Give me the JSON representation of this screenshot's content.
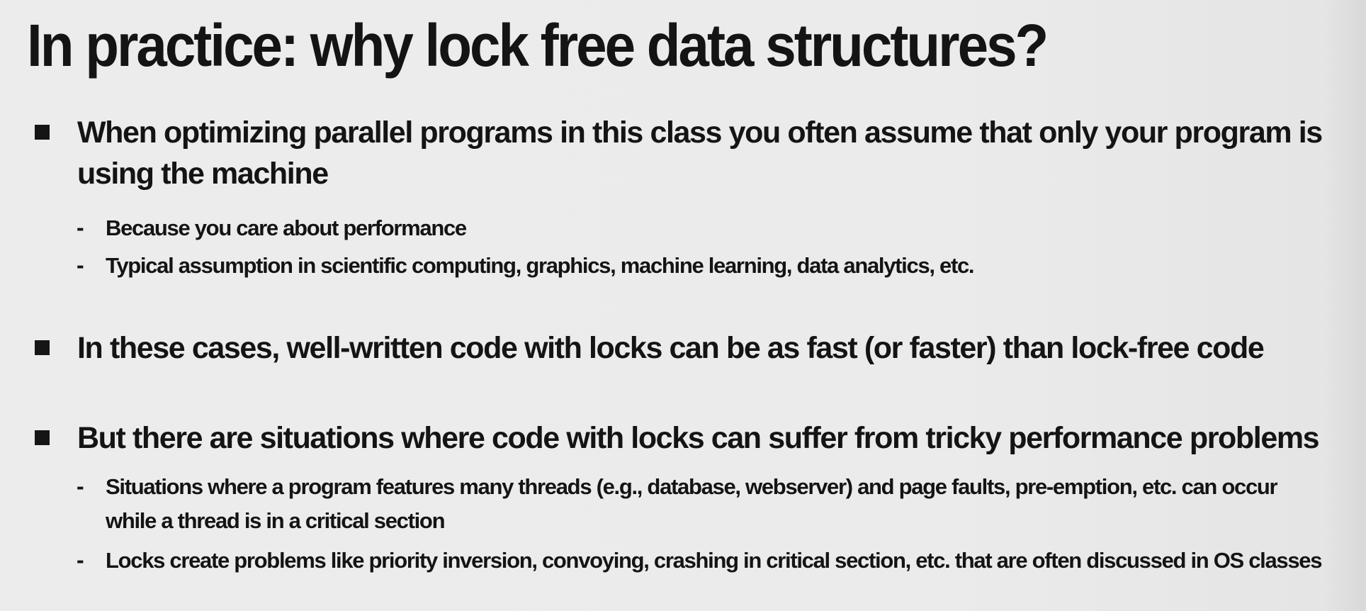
{
  "slide": {
    "title": "In practice: why lock free data structures?",
    "bullets": [
      {
        "lines": [
          "When optimizing parallel programs in this class you often assume that only your program is",
          "using the machine"
        ],
        "subs": [
          {
            "lines": [
              "Because you care about performance"
            ]
          },
          {
            "lines": [
              "Typical assumption in scientific computing, graphics, machine learning, data analytics, etc."
            ]
          }
        ]
      },
      {
        "lines": [
          "In these cases, well-written code with locks can be as fast (or faster) than lock-free code"
        ],
        "subs": []
      },
      {
        "lines": [
          "But there are situations where code with locks can suffer from tricky performance problems"
        ],
        "subs": [
          {
            "lines": [
              "Situations where a program features many threads (e.g., database, webserver) and page faults, pre-emption, etc. can occur",
              "while a thread is in a critical section"
            ]
          },
          {
            "lines": [
              "Locks create problems like priority inversion, convoying, crashing in critical section, etc. that are often discussed in OS classes"
            ]
          }
        ]
      }
    ],
    "bullet_marker": "square-bullet-icon",
    "sub_marker": "-"
  }
}
